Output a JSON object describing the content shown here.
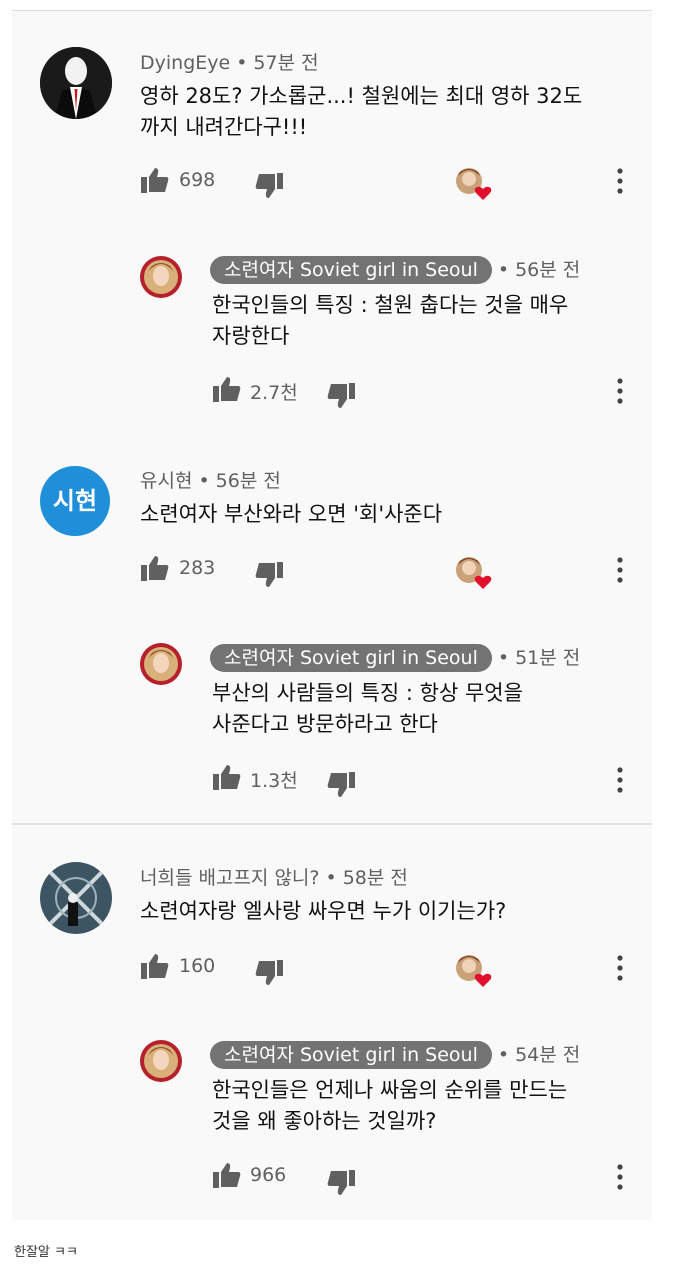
{
  "threads": [
    {
      "author": "DyingEye",
      "time": "57분 전",
      "text": [
        "영하 28도? 가소롭군...! 철원에는 최대 영하 32도",
        "까지 내려간다구!!!"
      ],
      "likes": "698",
      "reply": {
        "author": "소련여자 Soviet girl in Seoul",
        "time": "56분 전",
        "text": [
          "한국인들의 특징 : 철원 춥다는 것을 매우",
          "자랑한다"
        ],
        "likes": "2.7천"
      }
    },
    {
      "author": "유시현",
      "avatar_text": "시현",
      "time": "56분 전",
      "text": [
        "소련여자 부산와라 오면 '회'사준다"
      ],
      "likes": "283",
      "reply": {
        "author": "소련여자 Soviet girl in Seoul",
        "time": "51분 전",
        "text": [
          "부산의 사람들의 특징 : 항상 무엇을",
          "사준다고 방문하라고 한다"
        ],
        "likes": "1.3천"
      }
    },
    {
      "author": "너희들 배고프지 않니?",
      "time": "58분 전",
      "text": [
        "소련여자랑 엘사랑 싸우면 누가 이기는가?"
      ],
      "likes": "160",
      "reply": {
        "author": "소련여자 Soviet girl in Seoul",
        "time": "54분 전",
        "text": [
          "한국인들은 언제나 싸움의 순위를 만드는",
          "것을 왜 좋아하는 것일까?"
        ],
        "likes": "966"
      }
    }
  ],
  "caption": "한잘알 ㅋㅋ",
  "colors": {
    "background": "#f9f9f9",
    "meta_text": "#606060",
    "chip_bg": "#737373",
    "heart": "#e0102c",
    "avatar_blue": "#1e8fd8"
  },
  "icons": [
    "thumbs-up-icon",
    "thumbs-down-icon",
    "creator-heart-icon",
    "more-vert-icon"
  ]
}
